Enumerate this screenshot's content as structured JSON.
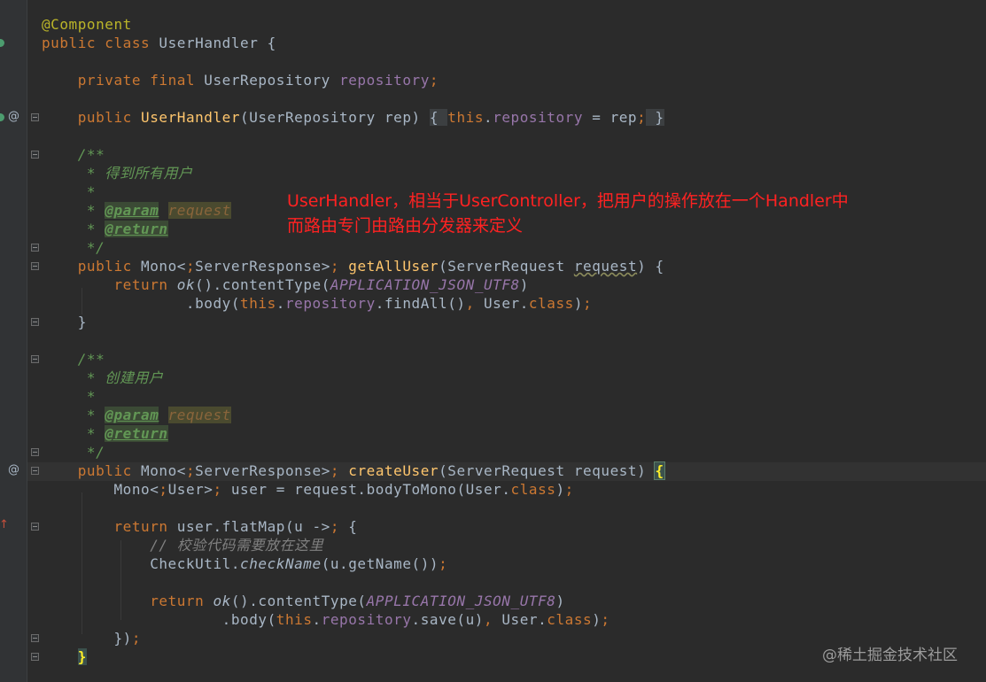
{
  "editor": {
    "annotation_text": "UserHandler，相当于UserController，把用户的操作放在一个Handler中",
    "annotation_text_2": "而路由专门由路由分发器来定义",
    "watermark": "@稀土掘金技术社区",
    "gutter_icons": [
      "implementation-icon",
      "override-icon",
      "error-arrow-icon",
      "fold-icon"
    ],
    "code_lines": [
      "@Component",
      "public class UserHandler {",
      "",
      "    private final UserRepository repository;",
      "",
      "    public UserHandler(UserRepository rep) { this.repository = rep; }",
      "",
      "    /**",
      "     * 得到所有用户",
      "     *",
      "     * @param request",
      "     * @return",
      "     */",
      "    public Mono<ServerResponse> getAllUser(ServerRequest request) {",
      "        return ok().contentType(APPLICATION_JSON_UTF8)",
      "                .body(this.repository.findAll(), User.class);",
      "    }",
      "",
      "    /**",
      "     * 创建用户",
      "     *",
      "     * @param request",
      "     * @return",
      "     */",
      "    public Mono<ServerResponse> createUser(ServerRequest request) {",
      "        Mono<User> user = request.bodyToMono(User.class);",
      "",
      "        return user.flatMap(u -> {",
      "            // 校验代码需要放在这里",
      "            CheckUtil.checkName(u.getName());",
      "",
      "            return ok().contentType(APPLICATION_JSON_UTF8)",
      "                    .body(this.repository.save(u), User.class);",
      "        });",
      "    }"
    ]
  }
}
